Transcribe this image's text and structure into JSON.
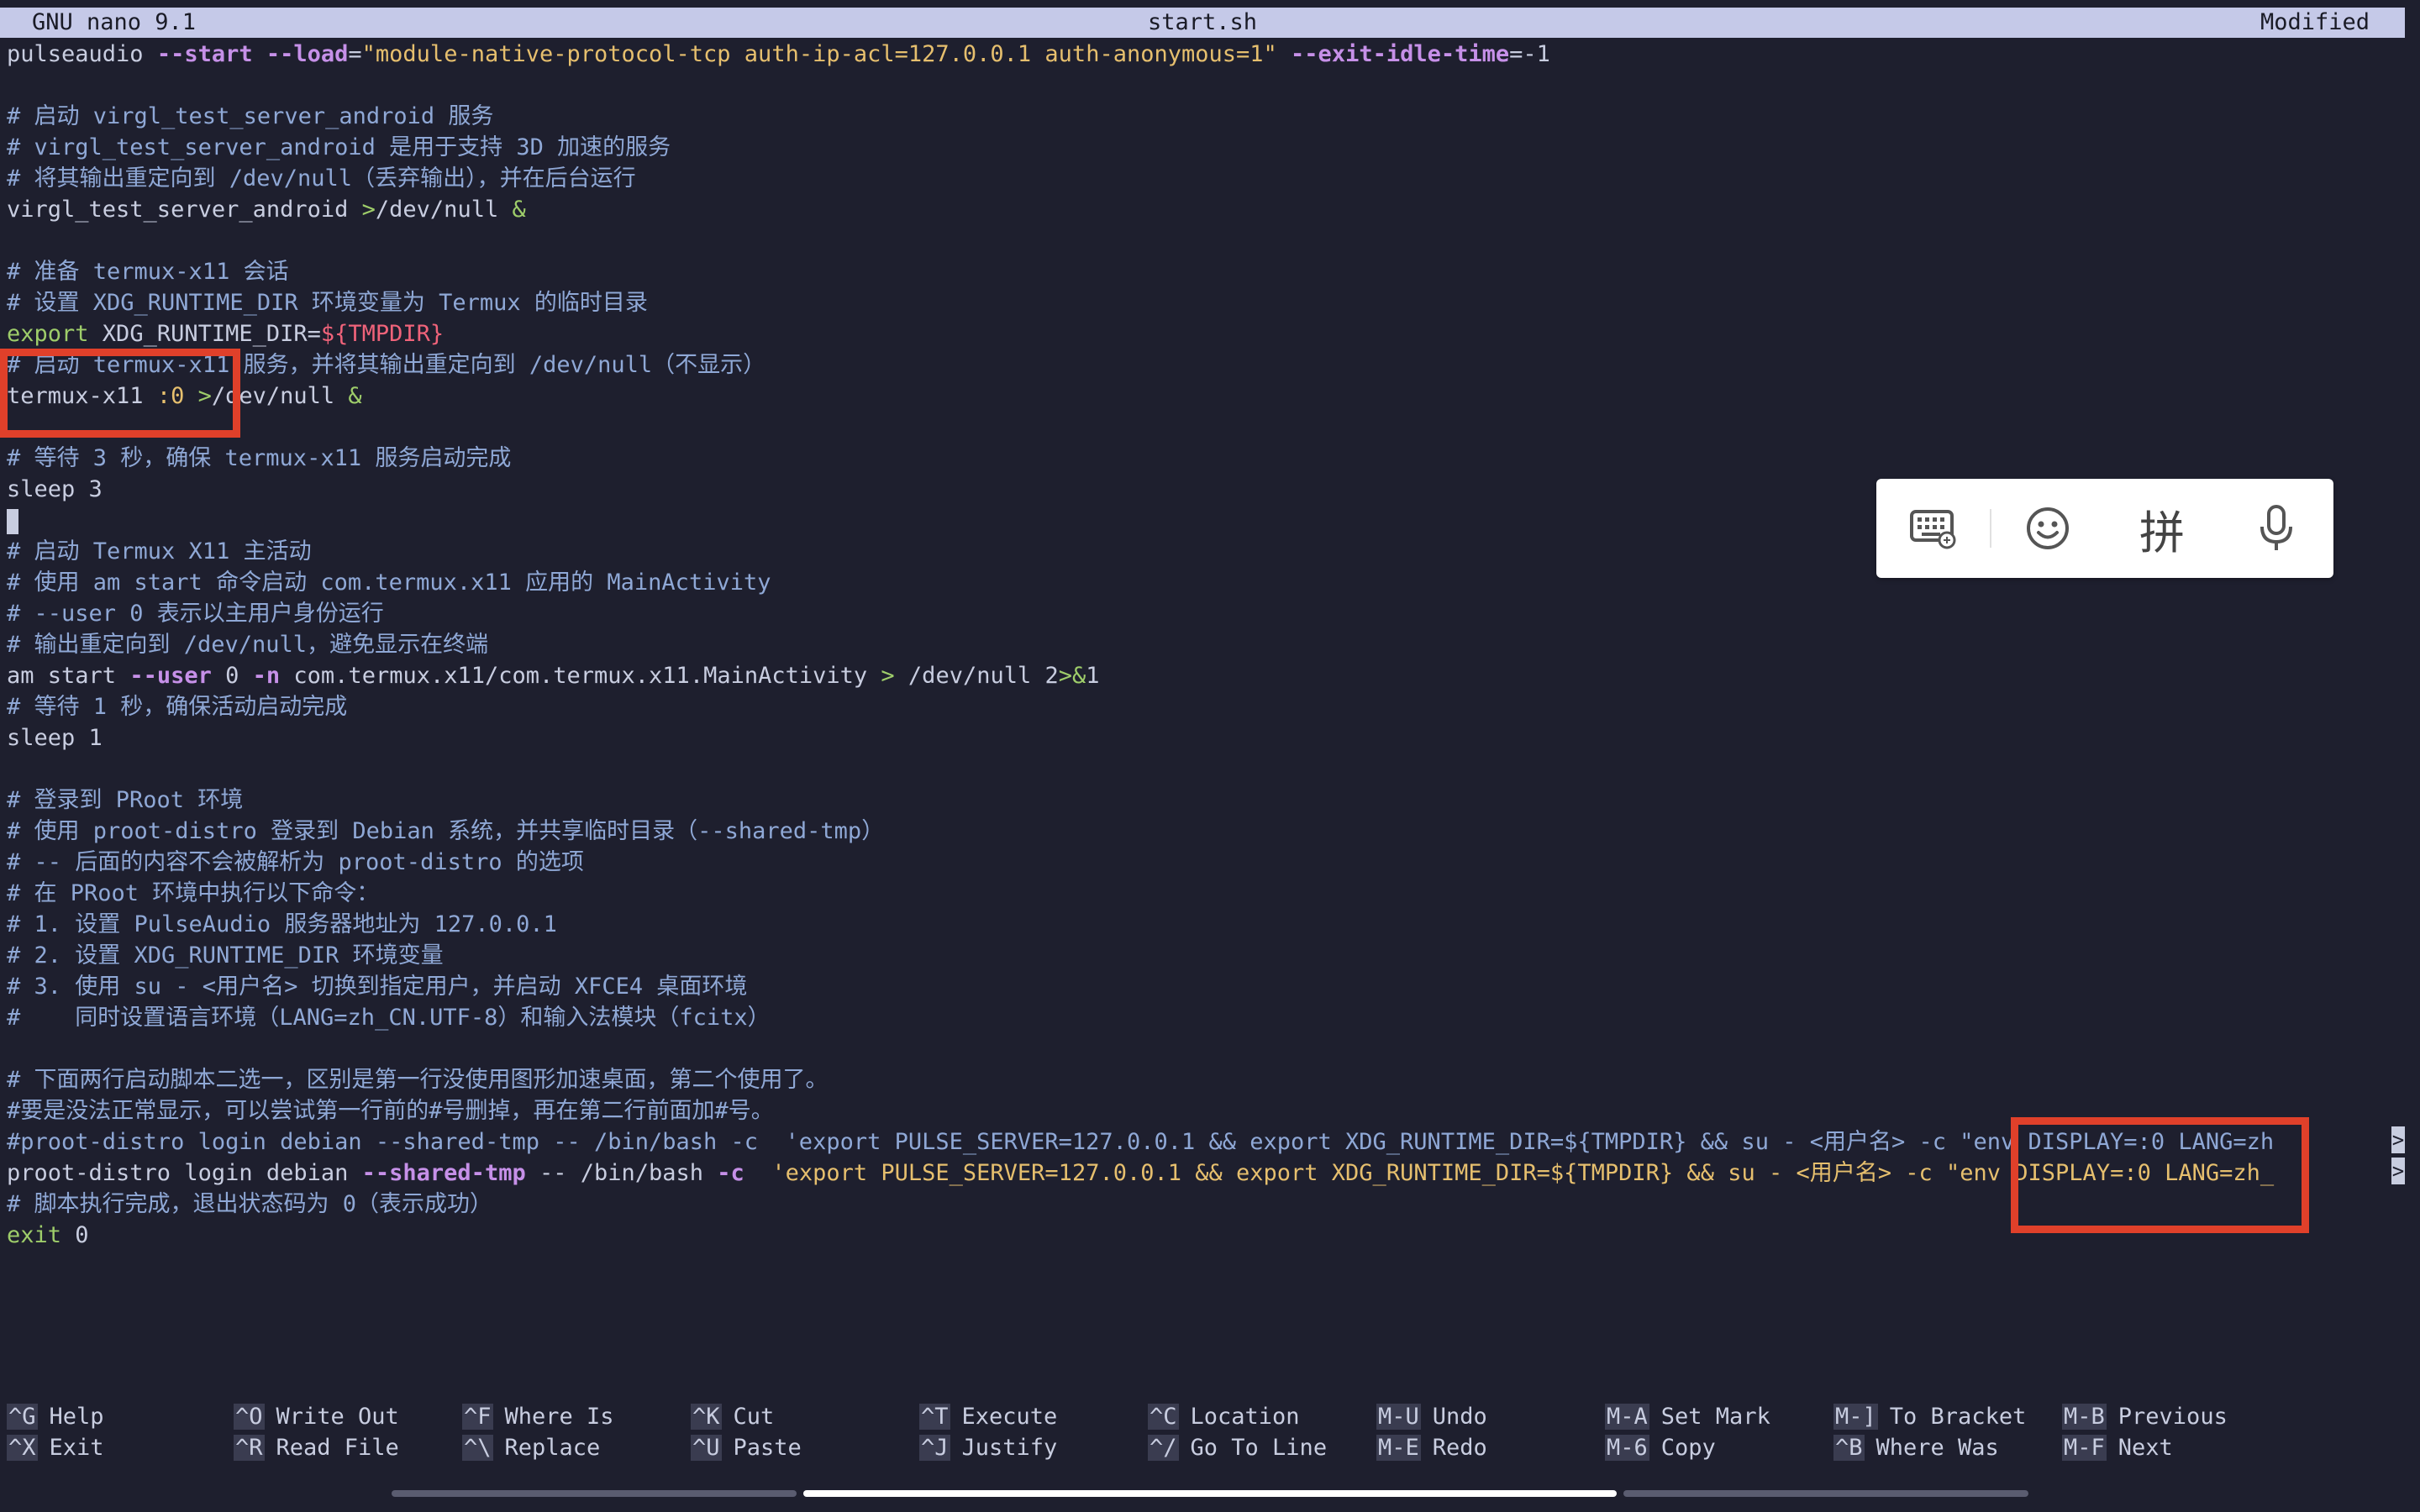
{
  "titlebar": {
    "app": "GNU nano 9.1",
    "file": "start.sh",
    "status": "Modified"
  },
  "lines": [
    [
      {
        "t": "pulseaudio ",
        "c": "cmd"
      },
      {
        "t": "--start --load",
        "c": "flag"
      },
      {
        "t": "=",
        "c": "cmd"
      },
      {
        "t": "\"module-native-protocol-tcp auth-ip-acl=127.0.0.1 auth-anonymous=1\"",
        "c": "str"
      },
      {
        "t": " ",
        "c": "cmd"
      },
      {
        "t": "--exit-idle-time",
        "c": "flag"
      },
      {
        "t": "=-1",
        "c": "cmd"
      }
    ],
    [],
    [
      {
        "t": "# 启动 virgl_test_server_android 服务",
        "c": "comment"
      }
    ],
    [
      {
        "t": "# virgl_test_server_android 是用于支持 3D 加速的服务",
        "c": "comment"
      }
    ],
    [
      {
        "t": "# 将其输出重定向到 /dev/null（丢弃输出），并在后台运行",
        "c": "comment"
      }
    ],
    [
      {
        "t": "virgl_test_server_android ",
        "c": "cmd"
      },
      {
        "t": ">",
        "c": "op"
      },
      {
        "t": "/dev/null ",
        "c": "cmd"
      },
      {
        "t": "&",
        "c": "op"
      }
    ],
    [],
    [
      {
        "t": "# 准备 termux-x11 会话",
        "c": "comment"
      }
    ],
    [
      {
        "t": "# 设置 XDG_RUNTIME_DIR 环境变量为 Termux 的临时目录",
        "c": "comment"
      }
    ],
    [
      {
        "t": "export",
        "c": "kw"
      },
      {
        "t": " XDG_RUNTIME_DIR=",
        "c": "cmd"
      },
      {
        "t": "${TMPDIR}",
        "c": "var"
      }
    ],
    [
      {
        "t": "# 启动 termux-x11 服务，并将其输出重定向到 /dev/null（不显示）",
        "c": "comment"
      }
    ],
    [
      {
        "t": "termux-x11 ",
        "c": "cmd"
      },
      {
        "t": ":0 ",
        "c": "str"
      },
      {
        "t": ">",
        "c": "op"
      },
      {
        "t": "/dev/null ",
        "c": "cmd"
      },
      {
        "t": "&",
        "c": "op"
      }
    ],
    [],
    [
      {
        "t": "# 等待 3 秒，确保 termux-x11 服务启动完成",
        "c": "comment"
      }
    ],
    [
      {
        "t": "sleep 3",
        "c": "cmd"
      }
    ],
    [
      {
        "t": "__CURSOR__",
        "c": "cursor"
      }
    ],
    [
      {
        "t": "# 启动 Termux X11 主活动",
        "c": "comment"
      }
    ],
    [
      {
        "t": "# 使用 am start 命令启动 com.termux.x11 应用的 MainActivity",
        "c": "comment"
      }
    ],
    [
      {
        "t": "# --user 0 表示以主用户身份运行",
        "c": "comment"
      }
    ],
    [
      {
        "t": "# 输出重定向到 /dev/null，避免显示在终端",
        "c": "comment"
      }
    ],
    [
      {
        "t": "am start ",
        "c": "cmd"
      },
      {
        "t": "--user",
        "c": "flag"
      },
      {
        "t": " 0 ",
        "c": "cmd"
      },
      {
        "t": "-n",
        "c": "flag"
      },
      {
        "t": " com.termux.x11/com.termux.x11.MainActivity ",
        "c": "cmd"
      },
      {
        "t": ">",
        "c": "op"
      },
      {
        "t": " /dev/null 2",
        "c": "cmd"
      },
      {
        "t": ">&",
        "c": "op"
      },
      {
        "t": "1",
        "c": "cmd"
      }
    ],
    [
      {
        "t": "# 等待 1 秒，确保活动启动完成",
        "c": "comment"
      }
    ],
    [
      {
        "t": "sleep 1",
        "c": "cmd"
      }
    ],
    [],
    [
      {
        "t": "# 登录到 PRoot 环境",
        "c": "comment"
      }
    ],
    [
      {
        "t": "# 使用 proot-distro 登录到 Debian 系统，并共享临时目录（--shared-tmp）",
        "c": "comment"
      }
    ],
    [
      {
        "t": "# -- 后面的内容不会被解析为 proot-distro 的选项",
        "c": "comment"
      }
    ],
    [
      {
        "t": "# 在 PRoot 环境中执行以下命令：",
        "c": "comment"
      }
    ],
    [
      {
        "t": "# 1. 设置 PulseAudio 服务器地址为 127.0.0.1",
        "c": "comment"
      }
    ],
    [
      {
        "t": "# 2. 设置 XDG_RUNTIME_DIR 环境变量",
        "c": "comment"
      }
    ],
    [
      {
        "t": "# 3. 使用 su - <用户名> 切换到指定用户，并启动 XFCE4 桌面环境",
        "c": "comment"
      }
    ],
    [
      {
        "t": "#    同时设置语言环境（LANG=zh_CN.UTF-8）和输入法模块（fcitx）",
        "c": "comment"
      }
    ],
    [],
    [
      {
        "t": "# 下面两行启动脚本二选一，区别是第一行没使用图形加速桌面，第二个使用了。",
        "c": "comment"
      }
    ],
    [
      {
        "t": "#要是没法正常显示，可以尝试第一行前的#号删掉，再在第二行前面加#号。",
        "c": "comment"
      }
    ],
    [
      {
        "t": "#proot-distro login debian --shared-tmp -- /bin/bash -c  'export PULSE_SERVER=127.0.0.1 && export XDG_RUNTIME_DIR=${TMPDIR} && su - <用户名> -c \"env DISPLAY=:0 LANG=zh",
        "c": "comment"
      },
      {
        "t": ">",
        "c": "marker"
      }
    ],
    [
      {
        "t": "proot-distro login debian ",
        "c": "cmd"
      },
      {
        "t": "--shared-tmp",
        "c": "flag"
      },
      {
        "t": " -- /bin/bash ",
        "c": "cmd"
      },
      {
        "t": "-c",
        "c": "flag"
      },
      {
        "t": "  'export PULSE_SERVER=127.0.0.1 && export XDG_RUNTIME_DIR=${TMPDIR} && su - <用户名> -c \"env DISPLAY=:0 LANG=zh_",
        "c": "str"
      },
      {
        "t": ">",
        "c": "marker"
      }
    ],
    [
      {
        "t": "# 脚本执行完成，退出状态码为 0（表示成功）",
        "c": "comment"
      }
    ],
    [
      {
        "t": "exit",
        "c": "kw"
      },
      {
        "t": " 0",
        "c": "cmd"
      }
    ]
  ],
  "ime_toolbar": {
    "keyboard_icon": "keyboard-icon",
    "emoji_icon": "emoji-icon",
    "pinyin_label": "拼",
    "mic_icon": "microphone-icon"
  },
  "shortcuts": [
    {
      "key": "^G",
      "label": "Help"
    },
    {
      "key": "^X",
      "label": "Exit"
    },
    {
      "key": "^O",
      "label": "Write Out"
    },
    {
      "key": "^R",
      "label": "Read File"
    },
    {
      "key": "^F",
      "label": "Where Is"
    },
    {
      "key": "^\\",
      "label": "Replace"
    },
    {
      "key": "^K",
      "label": "Cut"
    },
    {
      "key": "^U",
      "label": "Paste"
    },
    {
      "key": "^T",
      "label": "Execute"
    },
    {
      "key": "^J",
      "label": "Justify"
    },
    {
      "key": "^C",
      "label": "Location"
    },
    {
      "key": "^/",
      "label": "Go To Line"
    },
    {
      "key": "M-U",
      "label": "Undo"
    },
    {
      "key": "M-E",
      "label": "Redo"
    },
    {
      "key": "M-A",
      "label": "Set Mark"
    },
    {
      "key": "M-6",
      "label": "Copy"
    },
    {
      "key": "M-]",
      "label": "To Bracket"
    },
    {
      "key": "^B",
      "label": "Where Was"
    },
    {
      "key": "M-B",
      "label": "Previous"
    },
    {
      "key": "M-F",
      "label": "Next"
    }
  ],
  "colors": {
    "background": "#1e1f2e",
    "titlebar": "#c5c9e8",
    "comment": "#8fa8d6",
    "string": "#e6bf6e",
    "flag": "#c690e8",
    "operator": "#9ecd6a",
    "variable": "#f0637a",
    "annotation": "#e0402a"
  }
}
